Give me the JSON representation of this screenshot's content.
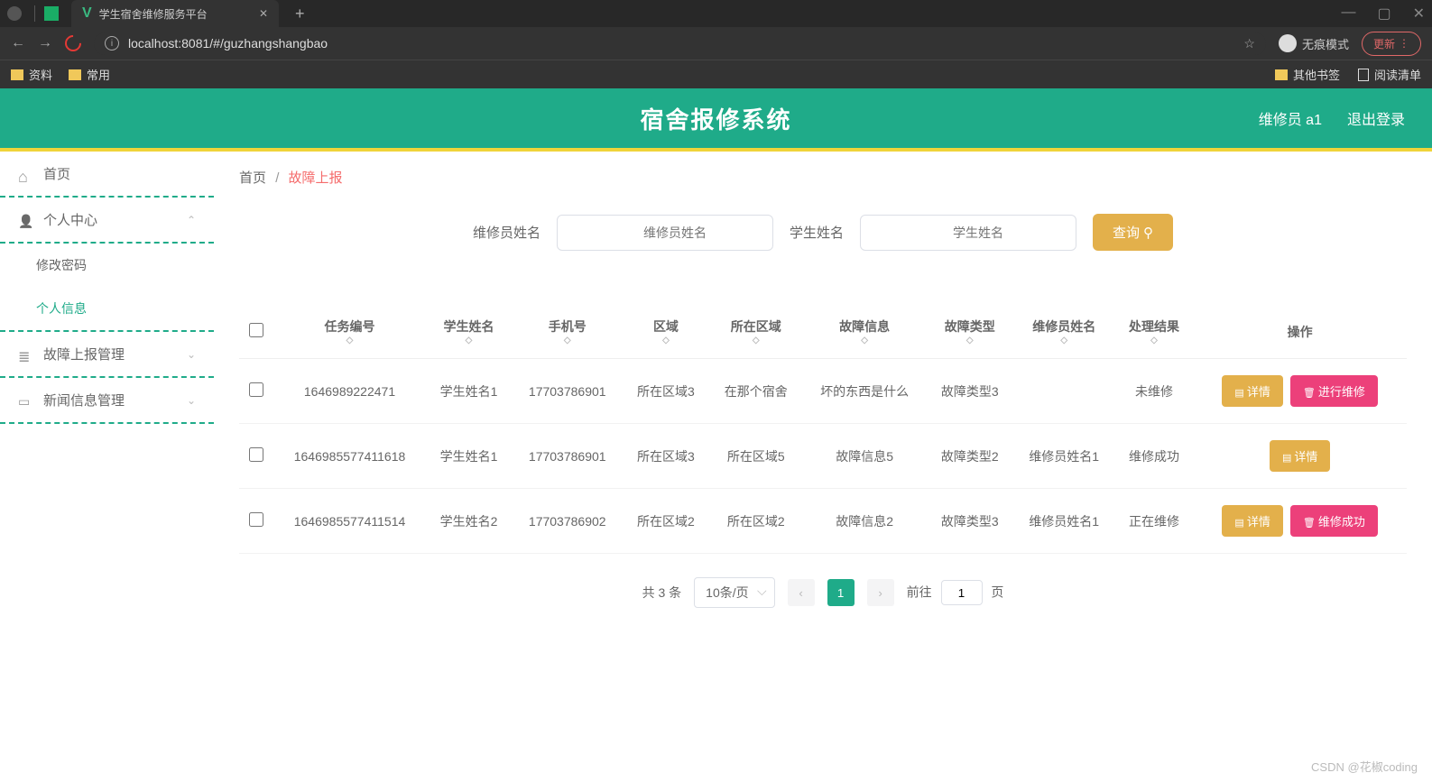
{
  "browser": {
    "tab_title": "学生宿舍维修服务平台",
    "url": "localhost:8081/#/guzhangshangbao",
    "incognito": "无痕模式",
    "update": "更新",
    "bookmarks": {
      "left": [
        "资料",
        "常用"
      ],
      "other": "其他书签",
      "reading": "阅读清单"
    }
  },
  "header": {
    "title": "宿舍报修系统",
    "user": "维修员 a1",
    "logout": "退出登录"
  },
  "sidebar": {
    "home": "首页",
    "personal": "个人中心",
    "change_pwd": "修改密码",
    "profile": "个人信息",
    "fault_mgmt": "故障上报管理",
    "news_mgmt": "新闻信息管理"
  },
  "breadcrumb": {
    "home": "首页",
    "current": "故障上报"
  },
  "search": {
    "repairman_label": "维修员姓名",
    "repairman_placeholder": "维修员姓名",
    "student_label": "学生姓名",
    "student_placeholder": "学生姓名",
    "query_btn": "查询"
  },
  "table": {
    "headers": [
      "任务编号",
      "学生姓名",
      "手机号",
      "区域",
      "所在区域",
      "故障信息",
      "故障类型",
      "维修员姓名",
      "处理结果",
      "操作"
    ],
    "rows": [
      {
        "task_no": "1646989222471",
        "student": "学生姓名1",
        "phone": "17703786901",
        "region": "所在区域3",
        "area": "在那个宿舍",
        "fault_info": "坏的东西是什么",
        "fault_type": "故障类型3",
        "repairman": "",
        "result": "未维修",
        "actions": [
          "详情",
          "进行维修"
        ]
      },
      {
        "task_no": "1646985577411618",
        "student": "学生姓名1",
        "phone": "17703786901",
        "region": "所在区域3",
        "area": "所在区域5",
        "fault_info": "故障信息5",
        "fault_type": "故障类型2",
        "repairman": "维修员姓名1",
        "result": "维修成功",
        "actions": [
          "详情"
        ]
      },
      {
        "task_no": "1646985577411514",
        "student": "学生姓名2",
        "phone": "17703786902",
        "region": "所在区域2",
        "area": "所在区域2",
        "fault_info": "故障信息2",
        "fault_type": "故障类型3",
        "repairman": "维修员姓名1",
        "result": "正在维修",
        "actions": [
          "详情",
          "维修成功"
        ]
      }
    ]
  },
  "pagination": {
    "total": "共 3 条",
    "page_size": "10条/页",
    "current": "1",
    "goto_prefix": "前往",
    "goto_value": "1",
    "goto_suffix": "页"
  },
  "watermark": "CSDN @花椒coding"
}
